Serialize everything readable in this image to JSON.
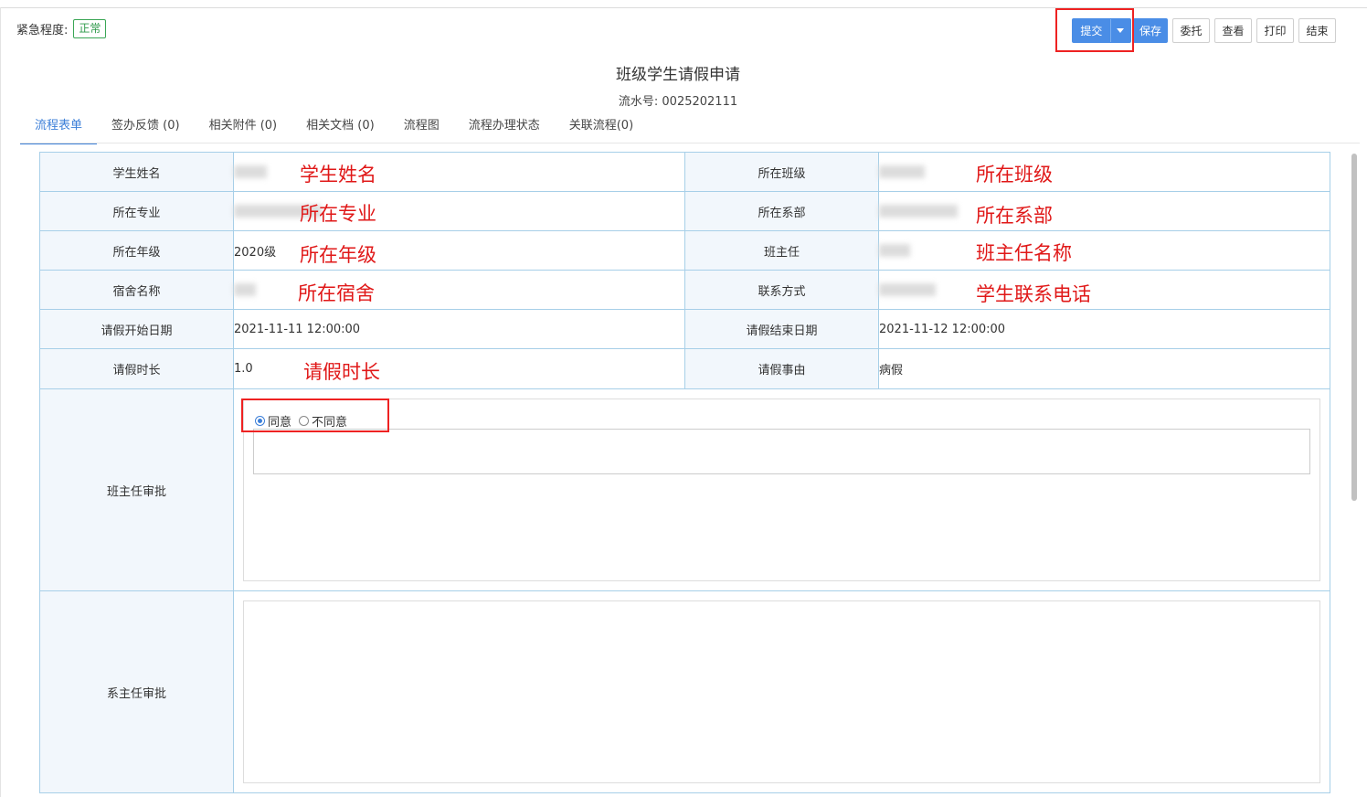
{
  "urgency": {
    "label": "紧急程度:",
    "value": "正常"
  },
  "toolbar": {
    "submit": "提交",
    "save": "保存",
    "delegate": "委托",
    "view": "查看",
    "print": "打印",
    "finish": "结束"
  },
  "form": {
    "title": "班级学生请假申请",
    "serial_label": "流水号:",
    "serial": "0025202111"
  },
  "tabs": [
    "流程表单",
    "签办反馈 (0)",
    "相关附件 (0)",
    "相关文档 (0)",
    "流程图",
    "流程办理状态",
    "关联流程(0)"
  ],
  "fields": {
    "student_name": {
      "label": "学生姓名",
      "annotation": "学生姓名"
    },
    "class": {
      "label": "所在班级",
      "annotation": "所在班级"
    },
    "major": {
      "label": "所在专业",
      "annotation": "所在专业"
    },
    "department": {
      "label": "所在系部",
      "annotation": "所在系部"
    },
    "grade": {
      "label": "所在年级",
      "value": "2020级",
      "annotation": "所在年级"
    },
    "head_teacher": {
      "label": "班主任",
      "annotation": "班主任名称"
    },
    "dorm": {
      "label": "宿舍名称",
      "annotation": "所在宿舍"
    },
    "contact": {
      "label": "联系方式",
      "annotation": "学生联系电话"
    },
    "start_date": {
      "label": "请假开始日期",
      "value": "2021-11-11 12:00:00"
    },
    "end_date": {
      "label": "请假结束日期",
      "value": "2021-11-12 12:00:00"
    },
    "duration": {
      "label": "请假时长",
      "value": "1.0",
      "annotation": "请假时长"
    },
    "reason": {
      "label": "请假事由",
      "value": "病假"
    }
  },
  "approvals": {
    "head_teacher": {
      "label": "班主任审批",
      "agree": "同意",
      "disagree": "不同意",
      "selected": "同意"
    },
    "dept_head": {
      "label": "系主任审批"
    }
  },
  "colors": {
    "accent": "#4a8de6",
    "annotation": "#e01818",
    "highlight_box": "#e22222",
    "badge": "#2e9a4a"
  }
}
